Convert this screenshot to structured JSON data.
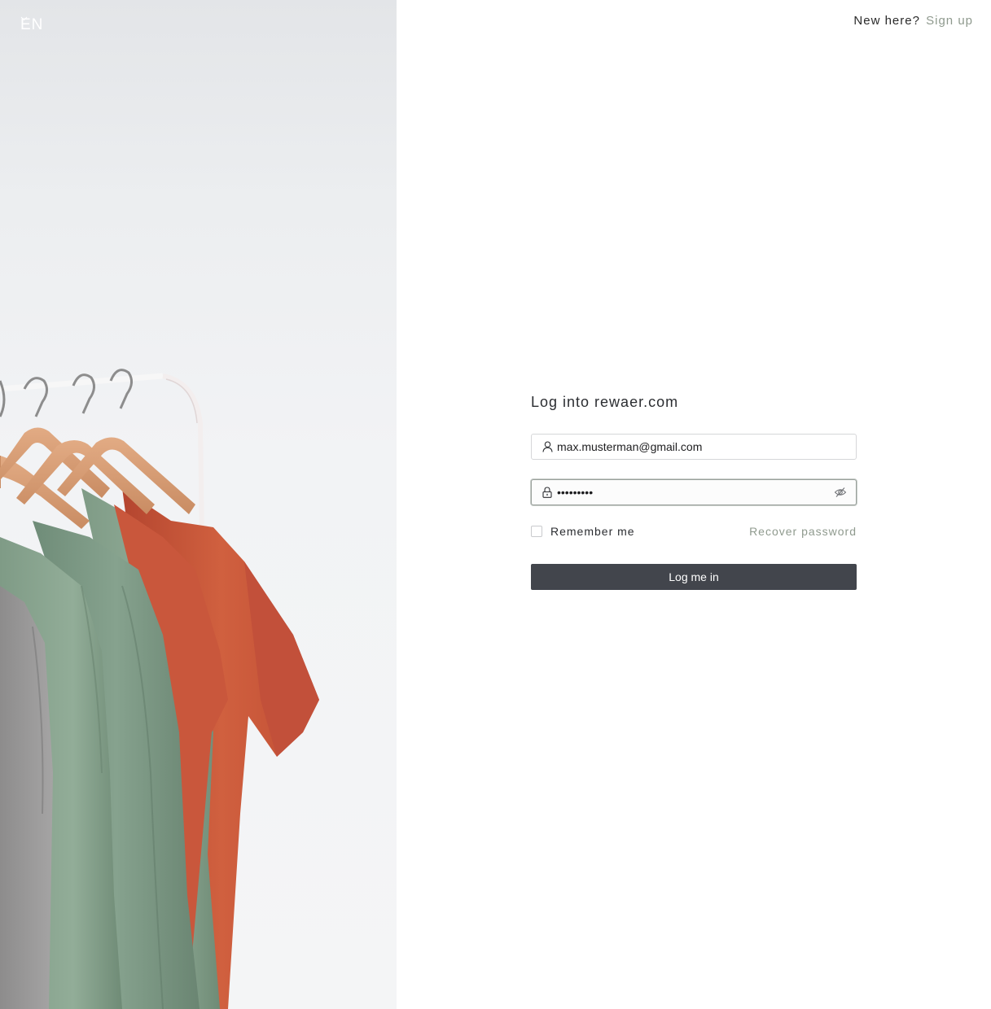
{
  "header": {
    "language": "EN",
    "signup_prompt": "New here?",
    "signup_link": "Sign up"
  },
  "login": {
    "title": "Log into rewaer.com",
    "email_value": "max.musterman@gmail.com",
    "password_value": "•••••••••",
    "remember_label": "Remember me",
    "recover_label": "Recover password",
    "submit_label": "Log me in"
  },
  "icons": {
    "language": "chevron-down-icon",
    "email": "user-icon",
    "password": "lock-icon",
    "visibility": "eye-off-icon"
  },
  "colors": {
    "button_bg": "#42454c",
    "link": "#8f9a8e",
    "shirt_green": "#7e9a86",
    "shirt_orange": "#cf5a3f",
    "hanger_wood": "#d9a07a"
  }
}
